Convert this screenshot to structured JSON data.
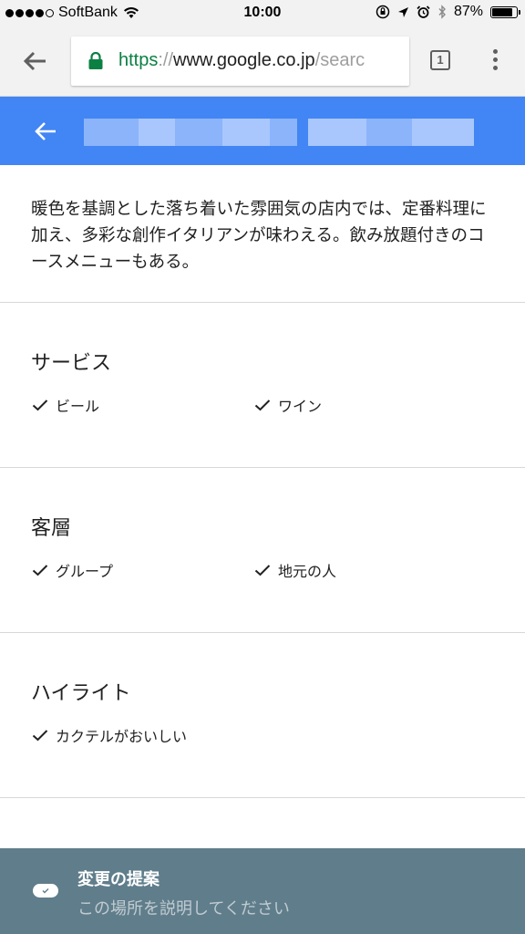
{
  "status_bar": {
    "carrier": "SoftBank",
    "time": "10:00",
    "battery_percent": "87%",
    "battery_level": 0.87
  },
  "browser": {
    "url_scheme": "https",
    "url_separator": "://",
    "url_host": "www.google.co.jp",
    "url_path": "/searc",
    "tab_count": "1",
    "secure_color": "#0b8043"
  },
  "header": {
    "color": "#4285f4",
    "title_obscured": true
  },
  "description": "暖色を基調とした落ち着いた雰囲気の店内では、定番料理に加え、多彩な創作イタリアンが味わえる。飲み放題付きのコースメニューもある。",
  "sections": [
    {
      "title": "サービス",
      "features": [
        "ビール",
        "ワイン"
      ]
    },
    {
      "title": "客層",
      "features": [
        "グループ",
        "地元の人"
      ]
    },
    {
      "title": "ハイライト",
      "features": [
        "カクテルがおいしい"
      ]
    }
  ],
  "suggest_bar": {
    "title": "変更の提案",
    "subtitle": "この場所を説明してください",
    "color": "#607d8b"
  },
  "icons": [
    "signal-icon",
    "wifi-icon",
    "orientation-lock-icon",
    "location-icon",
    "alarm-icon",
    "bluetooth-icon",
    "battery-icon",
    "back-arrow-icon",
    "lock-icon",
    "tab-switcher-icon",
    "overflow-menu-icon",
    "check-icon",
    "edit-toggle-icon"
  ]
}
